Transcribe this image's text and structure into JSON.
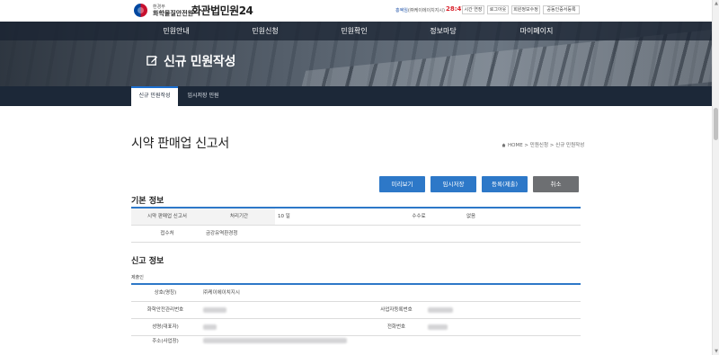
{
  "header": {
    "org_top": "환경부",
    "org_name": "화학물질안전원",
    "site_title": "화관법민원24",
    "user_name": "홍엑임",
    "user_company": "(㈜케이에이치지시)",
    "timer": "28:47",
    "util_buttons": [
      "시간 연장",
      "로그아웃",
      "회원정보수정",
      "공동인증서등록"
    ]
  },
  "nav": {
    "items": [
      "민원안내",
      "민원신청",
      "민원확인",
      "정보마당",
      "마이페이지"
    ]
  },
  "hero": {
    "title": "신규 민원작성"
  },
  "subtabs": [
    "신규 민원작성",
    "임시저장 민원"
  ],
  "page": {
    "title": "시약 판매업 신고서",
    "breadcrumb": "HOME > 민원신청 > 신규 민원작성"
  },
  "actions": {
    "preview": "미리보기",
    "temp_save": "임시저장",
    "submit": "등록(제출)",
    "cancel": "취소"
  },
  "basic_info": {
    "section_title": "기본 정보",
    "row1": {
      "name": "시약 판매업 신고서",
      "period_label": "처리기간",
      "period_value": "10 일",
      "fee_label": "수수료",
      "fee_value": "없음"
    },
    "row2": {
      "office_label": "접수처",
      "office_value": "금강유역환경청"
    }
  },
  "report_info": {
    "section_title": "신고 정보",
    "subtitle": "제출인",
    "company_label": "상호(명칭)",
    "company_value": "㈜케이에이치지시",
    "chem_no_label": "화학안전관리번호",
    "biz_no_label": "사업자등록번호",
    "rep_label": "성명(대표자)",
    "phone_label": "전화번호",
    "address_label": "주소(사업장)"
  },
  "colors": {
    "accent": "#2d78c8",
    "cancel": "#6d6f72",
    "nav_dark": "#1c2838",
    "timer": "#d9232d"
  }
}
